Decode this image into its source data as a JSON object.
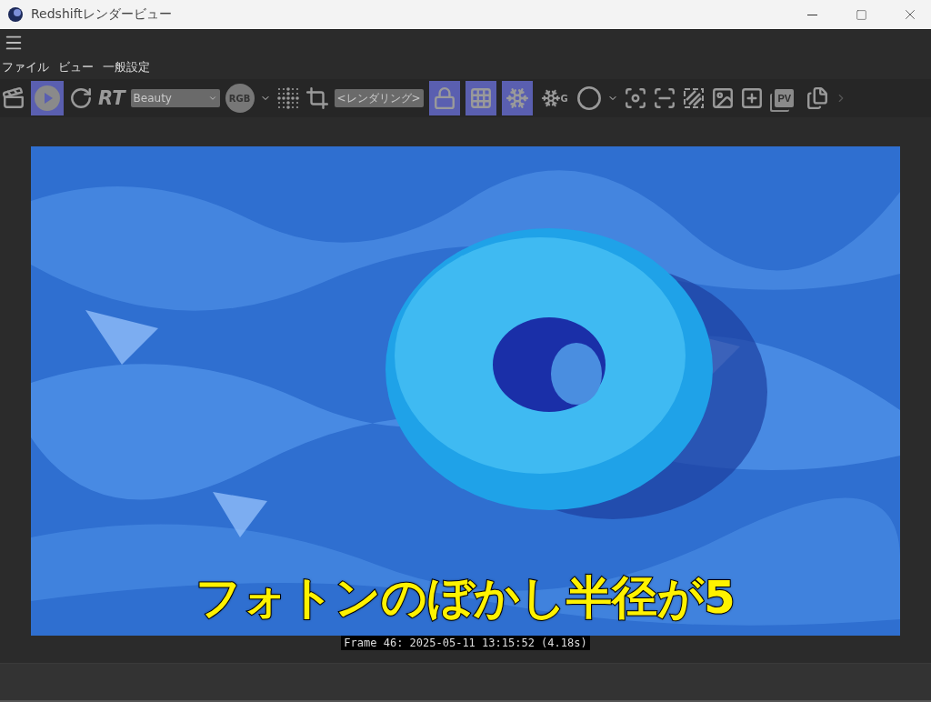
{
  "window": {
    "title": "Redshiftレンダービュー"
  },
  "menu": [
    "ファイル",
    "ビュー",
    "一般設定"
  ],
  "toolbar": {
    "render_button": {
      "on": true
    },
    "rt_label": "RT",
    "aov_select": {
      "value": "Beauty"
    },
    "rgb_badge": "RGB",
    "camera_select": {
      "value": "<レンダリング>"
    },
    "lock_button": {
      "on": true
    },
    "bucket_button": {
      "on": true
    },
    "freeze_button": {
      "on": true
    },
    "freeze_g_label": "G",
    "pv_label": "PV"
  },
  "viewport": {
    "caption": "フォトンのぼかし半径が5",
    "frame_info": "Frame 46: 2025-05-11 13:15:52 (4.18s)"
  }
}
